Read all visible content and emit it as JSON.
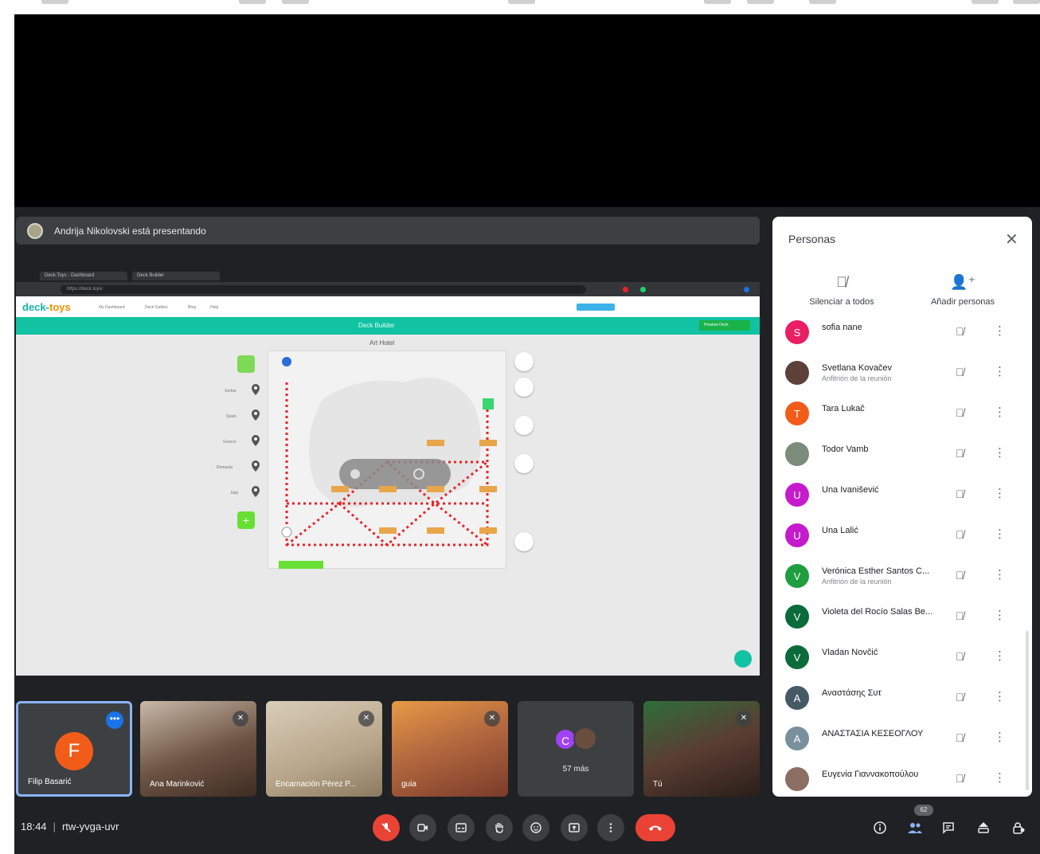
{
  "presenting_banner": "Andrija Nikolovski está presentando",
  "shared_screen": {
    "tabs": [
      "Deck.Toys - Dashboard",
      "Deck Builder"
    ],
    "url": "https://deck.toys/",
    "site_logo_a": "deck",
    "site_logo_b": "toys",
    "nav_links": [
      "My Dashboard",
      "Deck Gallery",
      "Blog",
      "Help"
    ],
    "deck_title": "Deck Builder",
    "art_label": "Art Hotel",
    "preview_label": "Preview Deck",
    "side_labels": [
      "Serbia",
      "Spain",
      "Greece",
      "Romania",
      "Italy"
    ],
    "colors": {
      "teal": "#11c2a3",
      "logo_orange": "#f39200",
      "dotted_path": "#e8252a"
    }
  },
  "tiles": {
    "filip": {
      "initial": "F",
      "name": "Filip Basarić",
      "avatar_color": "#f25c19"
    },
    "t2": {
      "name": "Ana Marinković"
    },
    "t3": {
      "name": "Encarnación Pérez P..."
    },
    "t4": {
      "name": "guia"
    },
    "more": {
      "initial": "C",
      "label": "57 más"
    },
    "t6": {
      "name": "Tú"
    }
  },
  "bottom_bar": {
    "time": "18:44",
    "room_code": "rtw-yvga-uvr",
    "people_count": "62"
  },
  "people_panel": {
    "title": "Personas",
    "mute_all": "Silenciar a todos",
    "add_people": "Añadir personas",
    "participants": [
      {
        "initial": "S",
        "name": "sofia nane",
        "sub": "",
        "color": "#e91e63"
      },
      {
        "initial": "",
        "name": "Svetlana Kovačev",
        "sub": "Anfitrión de la reunión",
        "color": "#5d4037"
      },
      {
        "initial": "T",
        "name": "Tara Lukač",
        "sub": "",
        "color": "#f25c19"
      },
      {
        "initial": "",
        "name": "Todor Vamb",
        "sub": "",
        "color": "#7b8c7a"
      },
      {
        "initial": "U",
        "name": "Una Ivanišević",
        "sub": "",
        "color": "#c51bcc"
      },
      {
        "initial": "U",
        "name": "Una Lalić",
        "sub": "",
        "color": "#c51bcc"
      },
      {
        "initial": "V",
        "name": "Verónica Esther Santos C...",
        "sub": "Anfitrión de la reunión",
        "color": "#1e9e3e"
      },
      {
        "initial": "V",
        "name": "Violeta del Rocío Salas Be...",
        "sub": "",
        "color": "#0b6b3a"
      },
      {
        "initial": "V",
        "name": "Vladan Novčić",
        "sub": "",
        "color": "#0b6b3a"
      },
      {
        "initial": "A",
        "name": "Αναστάσης Συτ",
        "sub": "",
        "color": "#455a64"
      },
      {
        "initial": "A",
        "name": "ΑΝΑΣΤΑΣΙΑ ΚΕΣΕΟΓΛΟΥ",
        "sub": "",
        "color": "#78909c"
      },
      {
        "initial": "",
        "name": "Ευγενία Γιαννακοπούλου",
        "sub": "",
        "color": "#8d6e63"
      }
    ]
  },
  "icons": {
    "mic_off": "mic-off-icon",
    "camera": "camera-icon",
    "captions": "captions-icon",
    "raise_hand": "hand-icon",
    "emoji": "emoji-icon",
    "present": "present-icon",
    "more": "more-vert-icon",
    "hangup": "hangup-icon",
    "info": "info-icon",
    "people": "people-icon",
    "chat": "chat-icon",
    "activities": "activities-icon",
    "lock": "lock-icon"
  }
}
